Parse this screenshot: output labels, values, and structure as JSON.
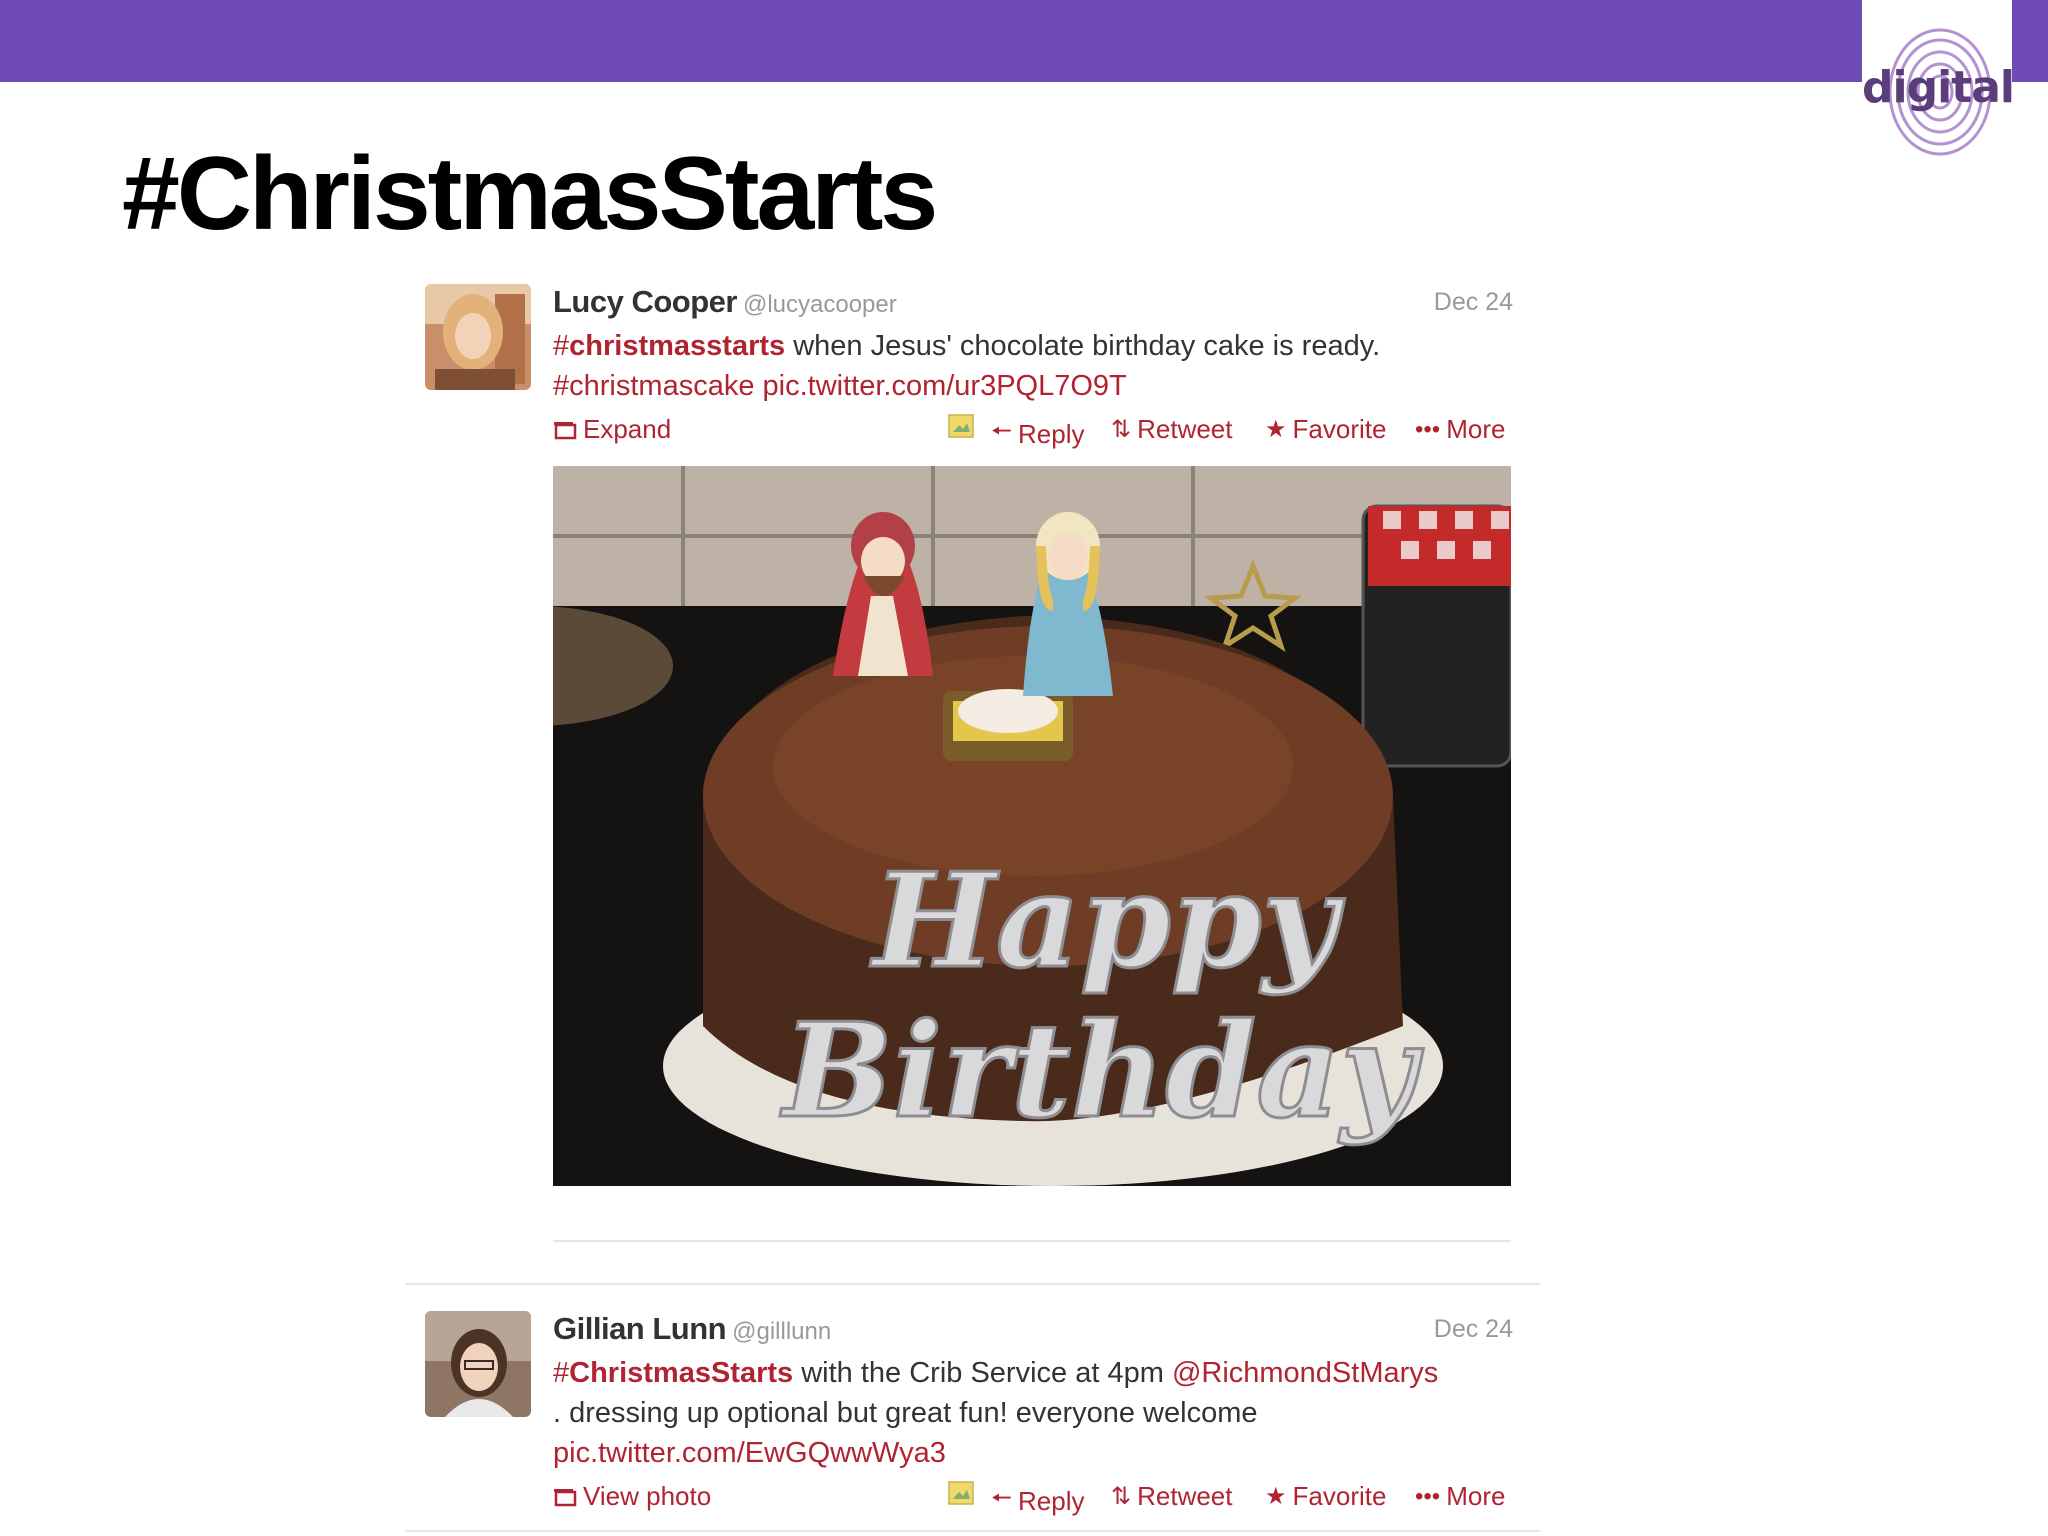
{
  "slide": {
    "title": "#ChristmasStarts"
  },
  "logo": {
    "text": "digital"
  },
  "tweets": [
    {
      "author": "Lucy Cooper",
      "handle": "@lucyacooper",
      "date": "Dec 24",
      "hashtag": "#",
      "hashtag_bold": "christmasstarts",
      "text_1": " when Jesus' chocolate birthday cake is ready.",
      "text_2": "#christmascake pic.twitter.com/ur3PQL7O9T",
      "expand_label": "Expand",
      "actions": {
        "reply": "Reply",
        "retweet": "Retweet",
        "favorite": "Favorite",
        "more": "More"
      },
      "photo_text": [
        "Happy",
        "Birthday"
      ]
    },
    {
      "author": "Gillian Lunn",
      "handle": "@gilllunn",
      "date": "Dec 24",
      "hashtag": "#",
      "hashtag_bold": "ChristmasStarts",
      "text_1": " with the Crib Service at 4pm ",
      "mention": "@RichmondStMarys",
      "text_2": ". dressing up optional but great fun! everyone welcome",
      "link": "pic.twitter.com/EwGQwwWya3",
      "expand_label": "View photo",
      "actions": {
        "reply": "Reply",
        "retweet": "Retweet",
        "favorite": "Favorite",
        "more": "More"
      }
    }
  ],
  "colors": {
    "header_bar": "#6f4bb7",
    "accent": "#b02432",
    "muted": "#999999"
  }
}
